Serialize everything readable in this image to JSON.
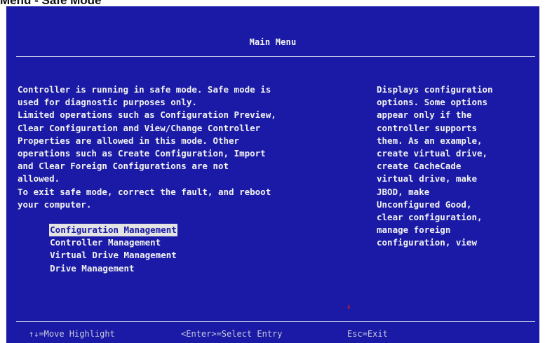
{
  "caption": "Menu - Safe Mode",
  "title": "Main Menu",
  "message_lines": [
    "Controller is running in safe mode. Safe mode is",
    "used for diagnostic purposes only.",
    "Limited operations such as Configuration Preview,",
    "Clear Configuration and View/Change Controller",
    "Properties are allowed in this mode. Other",
    "operations such as Create Configuration, Import",
    "and Clear Foreign Configurations are not",
    "allowed.",
    "To exit safe mode, correct the fault, and reboot",
    "your computer."
  ],
  "menu": [
    {
      "label": "Configuration Management",
      "selected": true
    },
    {
      "label": "Controller Management",
      "selected": false
    },
    {
      "label": "Virtual Drive Management",
      "selected": false
    },
    {
      "label": "Drive Management",
      "selected": false
    }
  ],
  "help_lines": [
    "Displays configuration",
    "options. Some options",
    "appear only if the",
    "controller supports",
    "them. As an example,",
    "create virtual drive,",
    "create CacheCade",
    "virtual drive, make",
    "JBOD, make",
    "Unconfigured Good,",
    "clear configuration,",
    "manage foreign",
    "configuration, view"
  ],
  "scroll_indicator": "↓",
  "hotkeys": {
    "move": "↑↓=Move Highlight",
    "select": "<Enter>=Select Entry",
    "exit": "Esc=Exit"
  },
  "colors": {
    "background": "#1a1aa6",
    "text": "#f2f2f2",
    "highlight": "#e3e3e3",
    "scroll_arrow": "#d21d1d"
  }
}
